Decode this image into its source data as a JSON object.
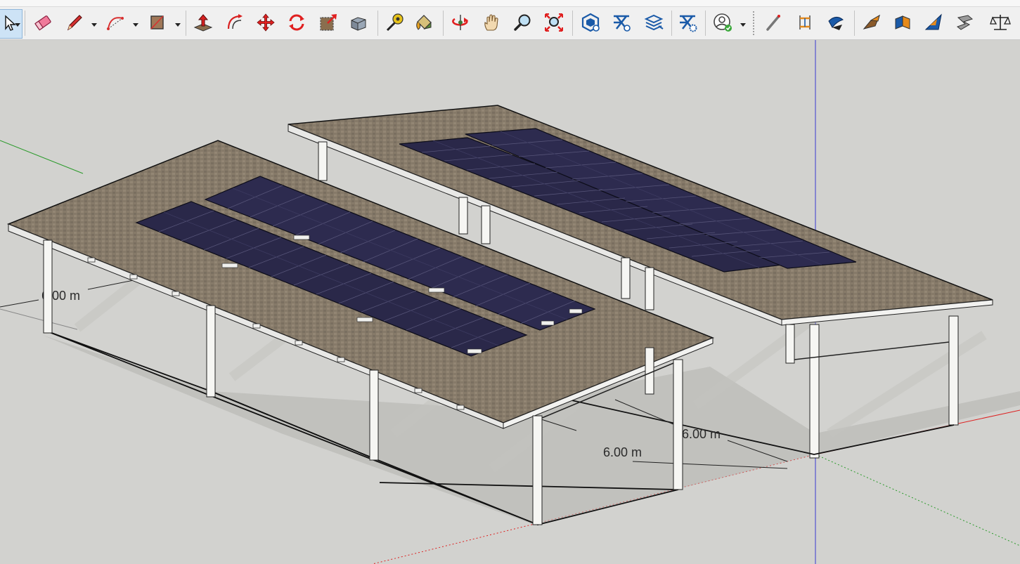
{
  "toolbar": {
    "tools": [
      {
        "id": "select",
        "icon": "select-arrow-icon",
        "active": true,
        "has_menu": true
      },
      {
        "id": "eraser",
        "icon": "eraser-icon"
      },
      {
        "id": "line",
        "icon": "pencil-line-icon",
        "has_menu": true
      },
      {
        "id": "arc",
        "icon": "arc-icon",
        "has_menu": true
      },
      {
        "id": "rectangle",
        "icon": "rectangle-icon",
        "has_menu": true
      },
      {
        "id": "push-pull",
        "icon": "push-pull-icon"
      },
      {
        "id": "offset",
        "icon": "offset-icon"
      },
      {
        "id": "move",
        "icon": "move-icon"
      },
      {
        "id": "rotate",
        "icon": "rotate-icon"
      },
      {
        "id": "scale",
        "icon": "scale-icon"
      },
      {
        "id": "follow-me",
        "icon": "follow-me-icon"
      },
      {
        "id": "tape-measure",
        "icon": "tape-measure-icon"
      },
      {
        "id": "paint-bucket",
        "icon": "paint-bucket-icon"
      },
      {
        "id": "orbit",
        "icon": "orbit-icon"
      },
      {
        "id": "pan",
        "icon": "pan-hand-icon"
      },
      {
        "id": "zoom",
        "icon": "zoom-magnifier-icon"
      },
      {
        "id": "zoom-extents",
        "icon": "zoom-extents-icon"
      },
      {
        "id": "3d-warehouse",
        "icon": "3d-warehouse-icon"
      },
      {
        "id": "extension-warehouse",
        "icon": "extension-warehouse-icon"
      },
      {
        "id": "layout",
        "icon": "send-to-layout-icon"
      },
      {
        "id": "extension-manager",
        "icon": "extension-manager-icon"
      },
      {
        "id": "account",
        "icon": "user-account-icon",
        "has_menu": true
      },
      {
        "id": "sandbox-smoove",
        "icon": "sandbox-smoove-icon"
      },
      {
        "id": "sandbox-stamp",
        "icon": "sandbox-stamp-icon"
      },
      {
        "id": "sandbox-drape",
        "icon": "sandbox-drape-icon"
      },
      {
        "id": "solid-outer-shell",
        "icon": "outer-shell-icon"
      },
      {
        "id": "solid-intersect",
        "icon": "intersect-icon"
      },
      {
        "id": "solid-union",
        "icon": "union-icon"
      },
      {
        "id": "solid-subtract",
        "icon": "subtract-icon"
      },
      {
        "id": "solid-split",
        "icon": "split-scale-icon"
      }
    ]
  },
  "viewport": {
    "dimensions": [
      {
        "name": "left-span-dimension",
        "label": "6.00 m"
      },
      {
        "name": "front-depth-dimension",
        "label": "6.00 m"
      },
      {
        "name": "right-depth-dimension",
        "label": "6.00 m"
      }
    ],
    "colors": {
      "background": "#d2d2cf",
      "roof": "#8c7f6e",
      "solar_panel": "#2a2849",
      "post": "#f7f7f4",
      "axis_red": "#d22",
      "axis_green": "#2a9a2a",
      "axis_blue": "#3a3ad0"
    }
  }
}
